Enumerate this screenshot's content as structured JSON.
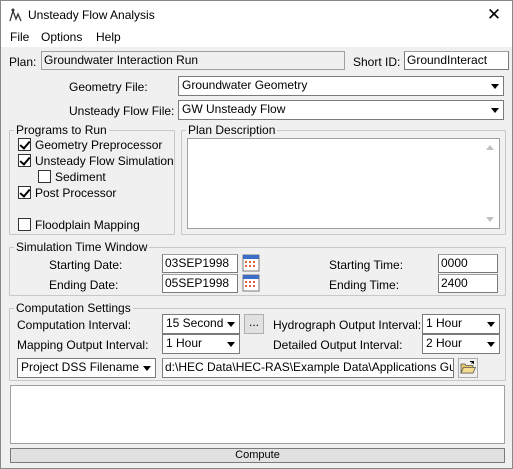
{
  "window": {
    "title": "Unsteady Flow Analysis",
    "close_glyph": "✕"
  },
  "menu": {
    "items": [
      "File",
      "Options",
      "Help"
    ]
  },
  "plan": {
    "label": "Plan:",
    "value": "Groundwater Interaction Run",
    "short_id_label": "Short ID:",
    "short_id_value": "GroundInteract"
  },
  "geometry": {
    "label": "Geometry File:",
    "value": "Groundwater Geometry"
  },
  "unsteady": {
    "label": "Unsteady Flow File:",
    "value": "GW Unsteady Flow"
  },
  "programs": {
    "title": "Programs to Run",
    "items": [
      {
        "label": "Geometry Preprocessor",
        "checked": true
      },
      {
        "label": "Unsteady Flow Simulation",
        "checked": true
      },
      {
        "label": "Sediment",
        "checked": false
      },
      {
        "label": "Post Processor",
        "checked": true
      },
      {
        "label": "Floodplain Mapping",
        "checked": false
      }
    ]
  },
  "plan_description": {
    "title": "Plan Description",
    "value": ""
  },
  "sim_window": {
    "title": "Simulation Time Window",
    "starting_date_label": "Starting Date:",
    "starting_date": "03SEP1998",
    "ending_date_label": "Ending Date:",
    "ending_date": "05SEP1998",
    "starting_time_label": "Starting Time:",
    "starting_time": "0000",
    "ending_time_label": "Ending Time:",
    "ending_time": "2400"
  },
  "computation": {
    "title": "Computation Settings",
    "comp_interval_label": "Computation Interval:",
    "comp_interval": "15 Second",
    "more_button": "...",
    "hydro_interval_label": "Hydrograph Output Interval:",
    "hydro_interval": "1 Hour",
    "mapping_interval_label": "Mapping Output Interval:",
    "mapping_interval": "1 Hour",
    "detailed_interval_label": "Detailed Output Interval:",
    "detailed_interval": "2 Hour",
    "dss_selector": "Project DSS Filename:",
    "dss_path": "d:\\HEC Data\\HEC-RAS\\Example Data\\Applications Guide\\Cha"
  },
  "compute_button": "Compute",
  "colors": {
    "dialog_bg": "#f0f0f0",
    "field_border": "#7a7a7a",
    "calendar_blue": "#3c6ec8"
  }
}
